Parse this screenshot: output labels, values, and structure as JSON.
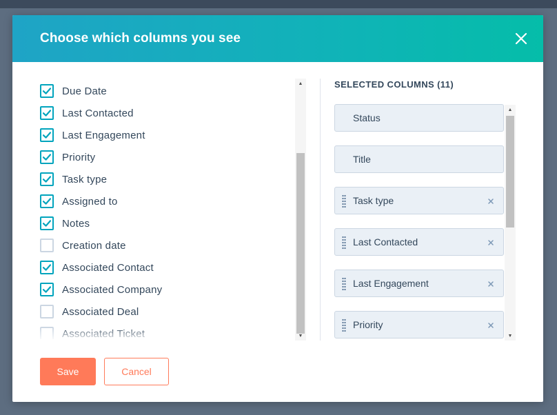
{
  "modal": {
    "title": "Choose which columns you see"
  },
  "available_columns": [
    {
      "label": "Due Date",
      "checked": true
    },
    {
      "label": "Last Contacted",
      "checked": true
    },
    {
      "label": "Last Engagement",
      "checked": true
    },
    {
      "label": "Priority",
      "checked": true
    },
    {
      "label": "Task type",
      "checked": true
    },
    {
      "label": "Assigned to",
      "checked": true
    },
    {
      "label": "Notes",
      "checked": true
    },
    {
      "label": "Creation date",
      "checked": false
    },
    {
      "label": "Associated Contact",
      "checked": true
    },
    {
      "label": "Associated Company",
      "checked": true
    },
    {
      "label": "Associated Deal",
      "checked": false
    },
    {
      "label": "Associated Ticket",
      "checked": false
    }
  ],
  "selected": {
    "heading": "SELECTED COLUMNS (11)",
    "items": [
      {
        "label": "Status",
        "removable": false
      },
      {
        "label": "Title",
        "removable": false
      },
      {
        "label": "Task type",
        "removable": true
      },
      {
        "label": "Last Contacted",
        "removable": true
      },
      {
        "label": "Last Engagement",
        "removable": true
      },
      {
        "label": "Priority",
        "removable": true
      }
    ]
  },
  "footer": {
    "save_label": "Save",
    "cancel_label": "Cancel"
  },
  "colors": {
    "accent": "#00a4bd",
    "primary_button": "#ff7a59",
    "text": "#33475b"
  },
  "icons": {
    "close": "close-icon",
    "check": "checkmark-icon",
    "drag": "drag-handle-icon",
    "remove": "remove-x-icon"
  }
}
